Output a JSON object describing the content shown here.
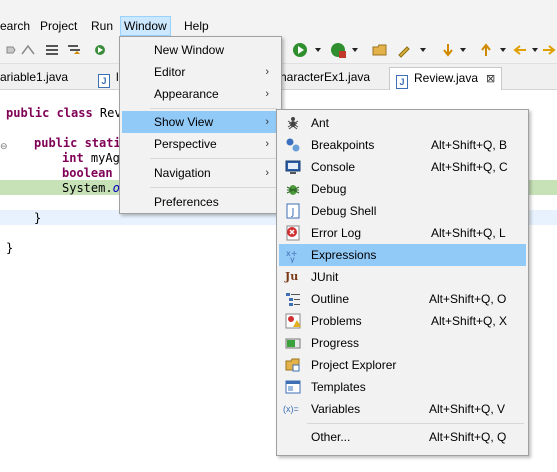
{
  "menubar": {
    "items": [
      "earch",
      "Project",
      "Run",
      "Window",
      "Help"
    ]
  },
  "tabs": [
    {
      "label": "ariable1.java"
    },
    {
      "label": "l"
    },
    {
      "label": "haracterEx1.java"
    },
    {
      "label": "Review.java",
      "close": "⊠"
    }
  ],
  "code": {
    "line1_kw": "public class ",
    "line1_rest": "Rev",
    "line2_kw": "public stati",
    "line3_kw": "int ",
    "line3_rest": "myAg",
    "line4_kw": "boolean ",
    "line5_rest": "System.",
    "line5_fld": "o",
    "line6": "}",
    "line7": "}"
  },
  "window_menu": {
    "items": [
      {
        "label": "New Window"
      },
      {
        "label": "Editor",
        "arrow": "›"
      },
      {
        "label": "Appearance",
        "arrow": "›"
      },
      {
        "label": "Show View",
        "arrow": "›"
      },
      {
        "label": "Perspective",
        "arrow": "›"
      },
      {
        "label": "Navigation",
        "arrow": "›"
      },
      {
        "label": "Preferences"
      }
    ]
  },
  "show_view_menu": {
    "items": [
      {
        "label": "Ant",
        "accel": "",
        "icon": "ant-icon"
      },
      {
        "label": "Breakpoints",
        "accel": "Alt+Shift+Q, B",
        "icon": "breakpoints-icon"
      },
      {
        "label": "Console",
        "accel": "Alt+Shift+Q, C",
        "icon": "console-icon"
      },
      {
        "label": "Debug",
        "accel": "",
        "icon": "debug-icon"
      },
      {
        "label": "Debug Shell",
        "accel": "",
        "icon": "debug-shell-icon"
      },
      {
        "label": "Error Log",
        "accel": "Alt+Shift+Q, L",
        "icon": "error-log-icon"
      },
      {
        "label": "Expressions",
        "accel": "",
        "icon": "expressions-icon"
      },
      {
        "label": "JUnit",
        "accel": "",
        "icon": "junit-icon"
      },
      {
        "label": "Outline",
        "accel": "Alt+Shift+Q, O",
        "icon": "outline-icon"
      },
      {
        "label": "Problems",
        "accel": "Alt+Shift+Q, X",
        "icon": "problems-icon"
      },
      {
        "label": "Progress",
        "accel": "",
        "icon": "progress-icon"
      },
      {
        "label": "Project Explorer",
        "accel": "",
        "icon": "project-explorer-icon"
      },
      {
        "label": "Templates",
        "accel": "",
        "icon": "templates-icon"
      },
      {
        "label": "Variables",
        "accel": "Alt+Shift+Q, V",
        "icon": "variables-icon"
      },
      {
        "label": "Other...",
        "accel": "Alt+Shift+Q, Q"
      }
    ],
    "variables_icon_text": "(x)=",
    "junit_icon_text": "Ju"
  },
  "colors": {
    "menu_highlight": "#91c9f7",
    "keyword": "#7f0055",
    "field": "#0000c0"
  }
}
